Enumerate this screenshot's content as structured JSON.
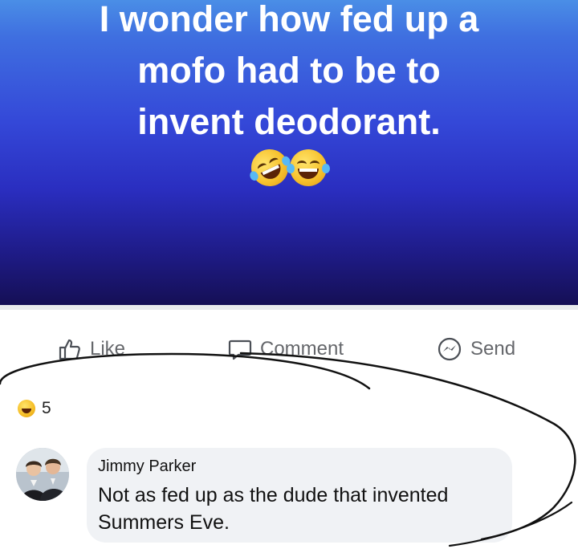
{
  "post": {
    "lines": [
      "I wonder how fed up a",
      "mofo had to be to",
      "invent deodorant."
    ],
    "emojis": [
      "rolling-on-floor-laughing",
      "face-with-tears-of-joy"
    ],
    "banner_colors": [
      "#4a8ee6",
      "#3448d8",
      "#150f55"
    ]
  },
  "actions": {
    "like": "Like",
    "comment": "Comment",
    "send": "Send"
  },
  "reactions": {
    "emoji": "laughing-face",
    "count": "5"
  },
  "comment": {
    "author": "Jimmy Parker",
    "text_line1": "Not as fed up as the dude that invented",
    "text_line2": "Summers Eve."
  }
}
